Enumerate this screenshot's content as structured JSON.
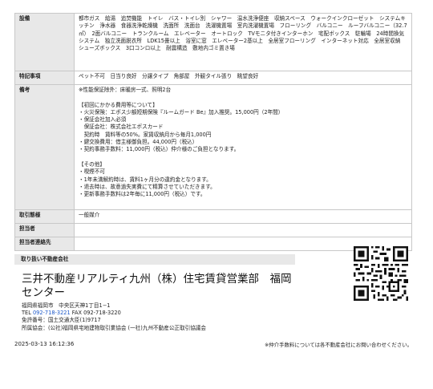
{
  "table": {
    "features_label": "設備",
    "features_text": "都市ガス　給湯　追焚機能　トイレ　バス・トイレ別　シャワー　温水洗浄便座　収納スペース　ウォークインクローゼット　システムキッチン　浄水器　食器洗浄乾燥機　洗面所　洗面台　洗濯機置場　室内洗濯機置場　フローリング　バルコニー　ルーフバルコニー（32.7㎡）　2面バルコニー　トランクルーム　エレベーター　オートロック　TVモニタ付きインターホン　宅配ボックス　駐輪場　24時間換気システム　独立洗面脱衣所　LDK15畳以上　浴室に窓　エレベーター2基以上　全居室フローリング　インターネット対応　全居室収納　シューズボックス　3口コンロ以上　耐震構造　敷地内ゴミ置き場",
    "tokki_label": "特記事項",
    "tokki_text": "ペット不可　日当り良好　分譲タイプ　角部屋　外観タイル張り　眺望良好",
    "biko_label": "備考",
    "biko_lines": [
      "※性能保証除外：床暖房一式、照明2台",
      "",
      "【初回にかかる費用等について】",
      "・火災保険：エポス少額短期保険『ルームガード Be』加入推奨。15,000円（2年間）",
      "・保証会社加入必須",
      "　保証会社：株式会社エポスカード",
      "　契約時　賃料等の50%。家賃収納月から毎月1,000円",
      "・鍵交換費用：借主様御負担。44,000円（税込）",
      "・契約事務手数料：11,000円（税込）仲介様のご負担となります。",
      "",
      "【その他】",
      "・喫煙不可",
      "・1年未満解約時は、賃料1ヶ月分の違約金となります。",
      "・退去時は、故意過失実費にて精算させていただきます。",
      "・更新事務手数料は2年毎に11,000円（税込）です。"
    ],
    "tori_label": "取引態様",
    "tori_text": "一般媒介",
    "tanto_label": "担当者",
    "tanto_text": "",
    "renraku_label": "担当者連絡先",
    "renraku_text": ""
  },
  "company": {
    "header": "取り扱い不動産会社",
    "name": "三井不動産リアルティ九州（株）住宅賃貸営業部　福岡センター",
    "address": "福岡県福岡市　中央区天神1丁目1−1",
    "tel_label": "TEL ",
    "tel": "092-718-3221",
    "fax": " FAX 092-718-3220",
    "license": "免許番号：国土交通大臣(1)9717",
    "association": "所属協会：(公社)福岡県宅地建物取引業協会 (一社)九州不動産公正取引協議会"
  },
  "footer": {
    "datetime": "2025-03-13 16:12:36",
    "note": "※仲介手数料については各不動産会社にお問い合わせください。"
  }
}
